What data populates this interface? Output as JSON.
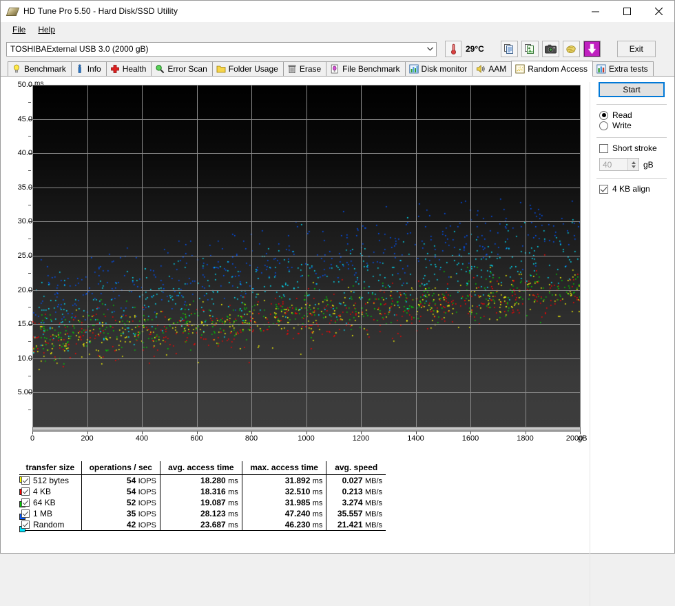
{
  "window": {
    "title": "HD Tune Pro 5.50 - Hard Disk/SSD Utility",
    "app_icon": "hard-disk-icon",
    "minimize": "–",
    "maximize": "□",
    "close": "✕"
  },
  "menubar": [
    {
      "label": "File",
      "accel": "F"
    },
    {
      "label": "Help",
      "accel": "H"
    }
  ],
  "toolbar": {
    "drive": "TOSHIBAExternal USB 3.0 (2000 gB)",
    "dropdown_icon": "chevron-down-icon",
    "thermometer_icon": "thermometer-icon",
    "temperature": "29°C",
    "buttons": [
      {
        "name": "copy-text-button",
        "icon": "copy-document-icon"
      },
      {
        "name": "copy-image-button",
        "icon": "copy-image-icon"
      },
      {
        "name": "screenshot-button",
        "icon": "camera-icon"
      },
      {
        "name": "cookie-button",
        "icon": "cookie-icon"
      },
      {
        "name": "download-button",
        "icon": "download-arrow-icon"
      }
    ],
    "exit_label": "Exit"
  },
  "tabs": [
    {
      "label": "Benchmark",
      "icon": "lightbulb-icon",
      "active": false
    },
    {
      "label": "Info",
      "icon": "info-icon",
      "active": false
    },
    {
      "label": "Health",
      "icon": "red-cross-icon",
      "active": false
    },
    {
      "label": "Error Scan",
      "icon": "magnifier-icon",
      "active": false
    },
    {
      "label": "Folder Usage",
      "icon": "folder-icon",
      "active": false
    },
    {
      "label": "Erase",
      "icon": "trash-icon",
      "active": false
    },
    {
      "label": "File Benchmark",
      "icon": "file-bulb-icon",
      "active": false
    },
    {
      "label": "Disk monitor",
      "icon": "bar-chart-icon",
      "active": false
    },
    {
      "label": "AAM",
      "icon": "speaker-icon",
      "active": false
    },
    {
      "label": "Random Access",
      "icon": "scatter-plot-icon",
      "active": true
    },
    {
      "label": "Extra tests",
      "icon": "extra-chart-icon",
      "active": false
    }
  ],
  "panel": {
    "start_label": "Start",
    "mode_read": "Read",
    "mode_write": "Write",
    "mode_selected": "Read",
    "short_stroke_label": "Short stroke",
    "short_stroke_checked": false,
    "short_stroke_value": "40",
    "short_stroke_unit": "gB",
    "align_label": "4 KB align",
    "align_checked": true
  },
  "chart_data": {
    "type": "scatter",
    "title": "",
    "xlabel": "gB",
    "ylabel": "ms",
    "xlim": [
      0,
      2000
    ],
    "ylim": [
      0,
      50
    ],
    "xticks": [
      0,
      200,
      400,
      600,
      800,
      1000,
      1200,
      1400,
      1600,
      1800,
      2000
    ],
    "xticklabels": [
      "0",
      "200",
      "400",
      "600",
      "800",
      "1000",
      "1200",
      "1400",
      "1600",
      "1800",
      "2000"
    ],
    "yticks": [
      5,
      10,
      15,
      20,
      25,
      30,
      35,
      40,
      45,
      50
    ],
    "yticklabels": [
      "5.00",
      "10.0",
      "15.0",
      "20.0",
      "25.0",
      "30.0",
      "35.0",
      "40.0",
      "45.0",
      "50.0"
    ],
    "grid": true,
    "background": "black-to-gray-vertical-gradient",
    "legend_position": "bottom-table",
    "series": [
      {
        "name": "512 bytes",
        "color": "#ffff00",
        "y_mean": 18.28,
        "y_max": 31.892,
        "points": 420
      },
      {
        "name": "4 KB",
        "color": "#ff0000",
        "y_mean": 18.316,
        "y_max": 32.51,
        "points": 420
      },
      {
        "name": "64 KB",
        "color": "#00cc00",
        "y_mean": 19.087,
        "y_max": 31.985,
        "points": 420
      },
      {
        "name": "1 MB",
        "color": "#0055ff",
        "y_mean": 28.123,
        "y_max": 47.24,
        "points": 420
      },
      {
        "name": "Random",
        "color": "#00e5ff",
        "y_mean": 23.687,
        "y_max": 46.23,
        "points": 420
      }
    ]
  },
  "results": {
    "headers": [
      "transfer size",
      "operations / sec",
      "avg. access time",
      "max. access time",
      "avg. speed"
    ],
    "rows": [
      {
        "color": "#ffff00",
        "checked": true,
        "size": "512 bytes",
        "size_unit": "bytes",
        "iops": "54 IOPS",
        "avg_access": "18.280 ms",
        "max_access": "31.892 ms",
        "avg_speed": "0.027 MB/s"
      },
      {
        "color": "#ff0000",
        "checked": true,
        "size": "4 KB",
        "size_unit": "KB",
        "iops": "54 IOPS",
        "avg_access": "18.316 ms",
        "max_access": "32.510 ms",
        "avg_speed": "0.213 MB/s"
      },
      {
        "color": "#00cc00",
        "checked": true,
        "size": "64 KB",
        "size_unit": "KB",
        "iops": "52 IOPS",
        "avg_access": "19.087 ms",
        "max_access": "31.985 ms",
        "avg_speed": "3.274 MB/s"
      },
      {
        "color": "#0055ff",
        "checked": true,
        "size": "1 MB",
        "size_unit": "MB",
        "iops": "35 IOPS",
        "avg_access": "28.123 ms",
        "max_access": "47.240 ms",
        "avg_speed": "35.557 MB/s"
      },
      {
        "color": "#00e5ff",
        "checked": true,
        "size": "Random",
        "size_unit": "",
        "iops": "42 IOPS",
        "avg_access": "23.687 ms",
        "max_access": "46.230 ms",
        "avg_speed": "21.421 MB/s"
      }
    ]
  }
}
